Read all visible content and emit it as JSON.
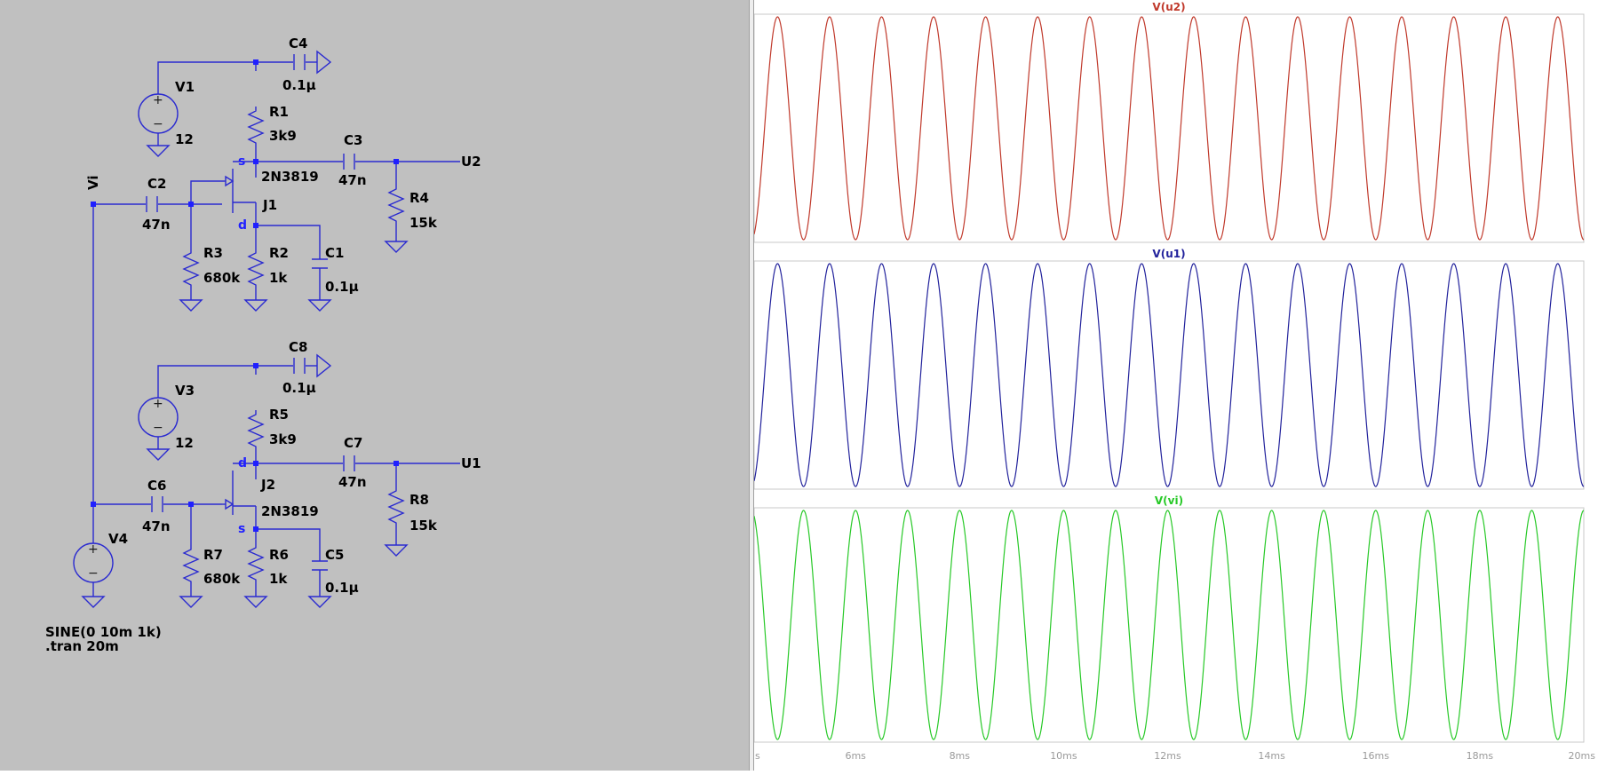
{
  "schematic": {
    "net_labels": {
      "vi": "Vi",
      "u2": "U2",
      "u1": "U1"
    },
    "components": {
      "V1": {
        "name": "V1",
        "value": "12"
      },
      "V3": {
        "name": "V3",
        "value": "12"
      },
      "V4": {
        "name": "V4"
      },
      "C4": {
        "name": "C4",
        "value": "0.1µ"
      },
      "C8": {
        "name": "C8",
        "value": "0.1µ"
      },
      "R1": {
        "name": "R1",
        "value": "3k9"
      },
      "R5": {
        "name": "R5",
        "value": "3k9"
      },
      "C3": {
        "name": "C3",
        "value": "47n"
      },
      "C7": {
        "name": "C7",
        "value": "47n"
      },
      "R4": {
        "name": "R4",
        "value": "15k"
      },
      "R8": {
        "name": "R8",
        "value": "15k"
      },
      "C2": {
        "name": "C2",
        "value": "47n"
      },
      "C6": {
        "name": "C6",
        "value": "47n"
      },
      "R3": {
        "name": "R3",
        "value": "680k"
      },
      "R7": {
        "name": "R7",
        "value": "680k"
      },
      "J1": {
        "name": "J1",
        "model": "2N3819"
      },
      "J2": {
        "name": "J2",
        "model": "2N3819"
      },
      "R2": {
        "name": "R2",
        "value": "1k"
      },
      "R6": {
        "name": "R6",
        "value": "1k"
      },
      "C1": {
        "name": "C1",
        "value": "0.1µ"
      },
      "C5": {
        "name": "C5",
        "value": "0.1µ"
      }
    },
    "pin_labels": {
      "j1_top": "s",
      "j1_bottom": "d",
      "j2_top": "d",
      "j2_bottom": "s"
    },
    "source_polarity": {
      "plus": "+",
      "minus": "−"
    },
    "directives": {
      "source": "SINE(0 10m 1k)",
      "tran": ".tran 20m"
    }
  },
  "waveform": {
    "traces": [
      {
        "id": "u2",
        "label": "V(u2)",
        "color": "#c0392b"
      },
      {
        "id": "u1",
        "label": "V(u1)",
        "color": "#22229c"
      },
      {
        "id": "vi",
        "label": "V(vi)",
        "color": "#27c927"
      }
    ],
    "x_axis": {
      "range_ms": [
        4.05,
        20
      ],
      "ticks": [
        {
          "label": "s",
          "value": 4.05
        },
        {
          "label": "6ms",
          "value": 6
        },
        {
          "label": "8ms",
          "value": 8
        },
        {
          "label": "10ms",
          "value": 10
        },
        {
          "label": "12ms",
          "value": 12
        },
        {
          "label": "14ms",
          "value": 14
        },
        {
          "label": "16ms",
          "value": 16
        },
        {
          "label": "18ms",
          "value": 18
        },
        {
          "label": "20ms",
          "value": 20
        }
      ]
    },
    "signal": {
      "frequency_khz": 1
    },
    "colors": {
      "grid": "#c8c8c8",
      "axis_text": "#9a9a9a"
    }
  }
}
